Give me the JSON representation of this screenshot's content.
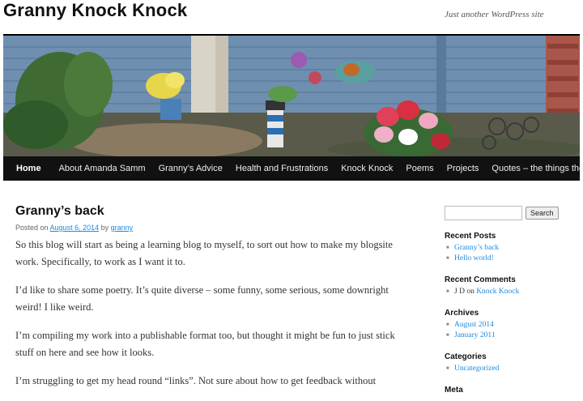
{
  "site": {
    "title": "Granny Knock Knock",
    "tagline": "Just another WordPress site"
  },
  "nav": {
    "items": [
      {
        "label": "Home"
      },
      {
        "label": "About Amanda Samm"
      },
      {
        "label": "Granny’s Advice"
      },
      {
        "label": "Health and Frustrations"
      },
      {
        "label": "Knock Knock"
      },
      {
        "label": "Poems"
      },
      {
        "label": "Projects"
      },
      {
        "label": "Quotes – the things they say"
      }
    ]
  },
  "post": {
    "title": "Granny’s back",
    "posted_on": "Posted on",
    "date": "August 6, 2014",
    "by": "by",
    "author": "granny",
    "paragraphs": [
      "So this blog will start as being a learning blog to myself, to sort out how to make my blogsite work. Specifically, to work as I want it to.",
      "I’d like to share some poetry. It’s quite diverse – some funny, some serious, some downright weird! I like weird.",
      "I’m  compiling my work into a publishable format too, but thought it might be fun to just stick stuff on here and see how it looks.",
      "I’m struggling to get my head round “links”. Not sure about how to get feedback without"
    ]
  },
  "sidebar": {
    "search_button": "Search",
    "search_value": "",
    "recent_posts": {
      "title": "Recent Posts",
      "items": [
        "Granny’s back",
        "Hello world!"
      ]
    },
    "recent_comments": {
      "title": "Recent Comments",
      "author": "J D",
      "on": "on",
      "post": "Knock Knock"
    },
    "archives": {
      "title": "Archives",
      "items": [
        "August 2014",
        "January 2011"
      ]
    },
    "categories": {
      "title": "Categories",
      "items": [
        "Uncategorized"
      ]
    },
    "meta": {
      "title": "Meta"
    }
  }
}
